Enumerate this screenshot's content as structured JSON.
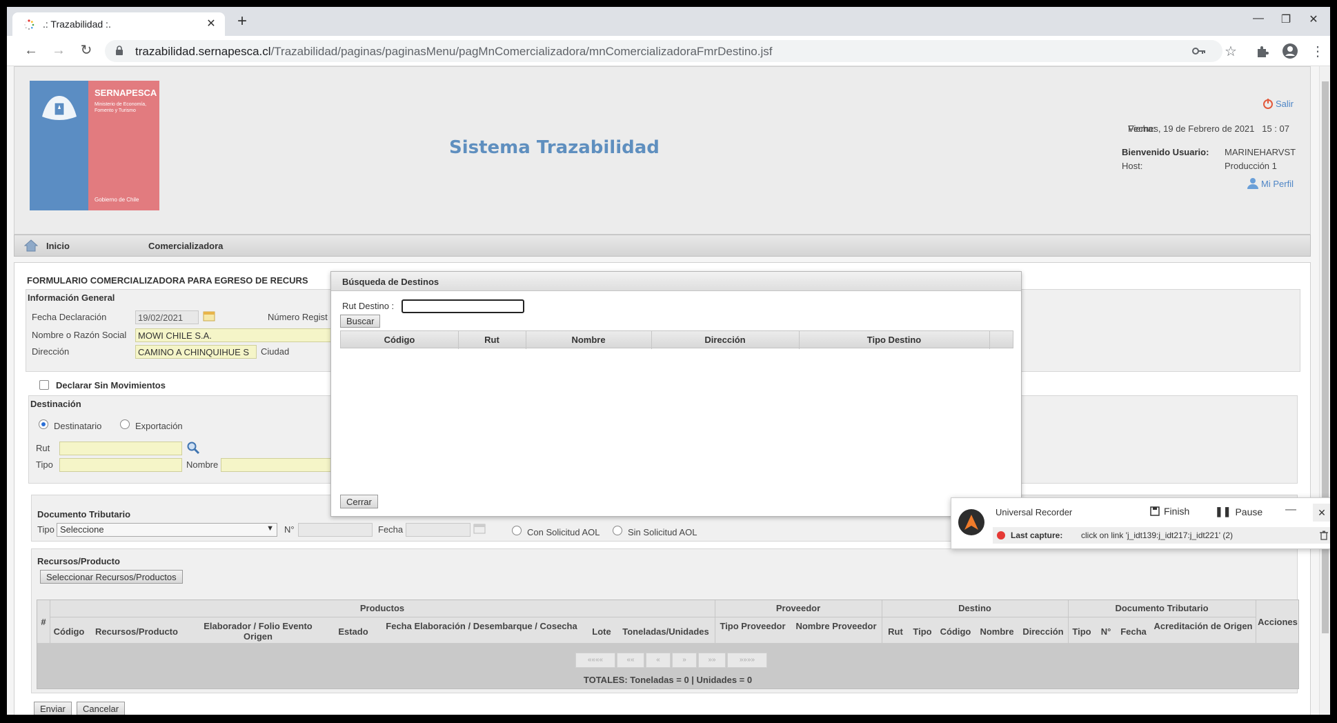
{
  "browser": {
    "tab_title": ".: Trazabilidad :.",
    "url_host": "trazabilidad.sernapesca.cl",
    "url_path": "/Trazabilidad/paginas/paginasMenu/pagMnComercializadora/mnComercializadoraFmrDestino.jsf"
  },
  "header": {
    "logo": {
      "name": "SERNAPESCA",
      "ministry": "Ministerio de Economía, Fomento y Turismo",
      "gov": "Gobierno de Chile"
    },
    "app_title": "Sistema Trazabilidad",
    "salir": "Salir",
    "fecha_label": "Fecha:",
    "fecha_value": "Viernes, 19 de Febrero de 2021   15 : 07",
    "welcome_label": "Bienvenido Usuario:",
    "welcome_value": "MARINEHARVST",
    "host_label": "Host:",
    "host_value": "Producción 1",
    "perfil": "Mi Perfil"
  },
  "menu": {
    "inicio": "Inicio",
    "comercializadora": "Comercializadora"
  },
  "form": {
    "title": "FORMULARIO COMERCIALIZADORA PARA EGRESO DE RECURS",
    "general": {
      "title": "Información General",
      "fecha_label": "Fecha Declaración",
      "fecha_value": "19/02/2021",
      "numero_label": "Número Regist",
      "nombre_label": "Nombre o Razón Social",
      "nombre_value": "MOWI CHILE S.A.",
      "direccion_label": "Dirección",
      "direccion_value": "CAMINO A CHINQUIHUE S",
      "ciudad_label": "Ciudad"
    },
    "declarar": "Declarar Sin Movimientos",
    "destinacion": {
      "title": "Destinación",
      "destinatario": "Destinatario",
      "exportacion": "Exportación",
      "rut_label": "Rut",
      "tipo_label": "Tipo",
      "nombre_label": "Nombre"
    },
    "documento": {
      "title": "Documento Tributario",
      "tipo_label": "Tipo",
      "tipo_value": "Seleccione",
      "n_label": "N°",
      "fecha_label": "Fecha",
      "con_aol": "Con Solicitud AOL",
      "sin_aol": "Sin Solicitud AOL"
    },
    "recursos": {
      "title": "Recursos/Producto",
      "select_button": "Seleccionar Recursos/Productos"
    },
    "grid": {
      "groups": [
        "Productos",
        "Proveedor",
        "Destino",
        "Documento Tributario"
      ],
      "hash": "#",
      "acciones": "Acciones",
      "columns": [
        "Código",
        "Recursos/Producto",
        "Elaborador / Folio Evento Origen",
        "Estado",
        "Fecha Elaboración / Desembarque / Cosecha",
        "Lote",
        "Toneladas/Unidades",
        "Tipo Proveedor",
        "Nombre Proveedor",
        "Rut",
        "Tipo",
        "Código",
        "Nombre",
        "Dirección",
        "Tipo",
        "N°",
        "Fecha",
        "Acreditación de Origen"
      ],
      "pager": [
        "««««",
        "««",
        "«",
        "»",
        "»»",
        "»»»»"
      ],
      "totales": "TOTALES:  Toneladas = 0 | Unidades = 0"
    },
    "enviar": "Enviar",
    "cancelar": "Cancelar"
  },
  "modal": {
    "title": "Búsqueda de Destinos",
    "rut_label": "Rut Destino :",
    "rut_value": "",
    "buscar": "Buscar",
    "columns": [
      "Código",
      "Rut",
      "Nombre",
      "Dirección",
      "Tipo Destino"
    ],
    "cerrar": "Cerrar"
  },
  "recorder": {
    "title": "Universal Recorder",
    "finish": "Finish",
    "pause": "Pause",
    "last_label": "Last capture:",
    "last_value": "click on link 'j_idt139:j_idt217:j_idt221' (2)"
  },
  "colors": {
    "app_title": "#5f8fbf",
    "link": "#4f86c6",
    "logo_blue": "#5b8dc3",
    "logo_red": "#e27b7f",
    "input_yellow": "#f5f5c8",
    "recording": "#e53935"
  }
}
